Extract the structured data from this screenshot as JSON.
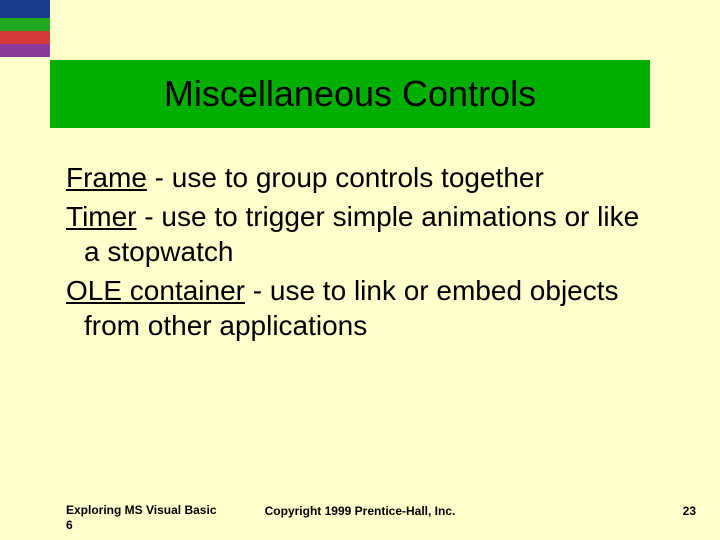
{
  "header": {
    "title": "Miscellaneous Controls"
  },
  "items": [
    {
      "term": "Frame",
      "desc": " - use to group controls together"
    },
    {
      "term": "Timer",
      "desc": " - use to trigger simple animations or like a stopwatch"
    },
    {
      "term": "OLE container",
      "desc": " - use to link or embed objects from other applications"
    }
  ],
  "footer": {
    "left": "Exploring MS Visual Basic 6",
    "center": "Copyright 1999 Prentice-Hall, Inc.",
    "page": "23"
  }
}
